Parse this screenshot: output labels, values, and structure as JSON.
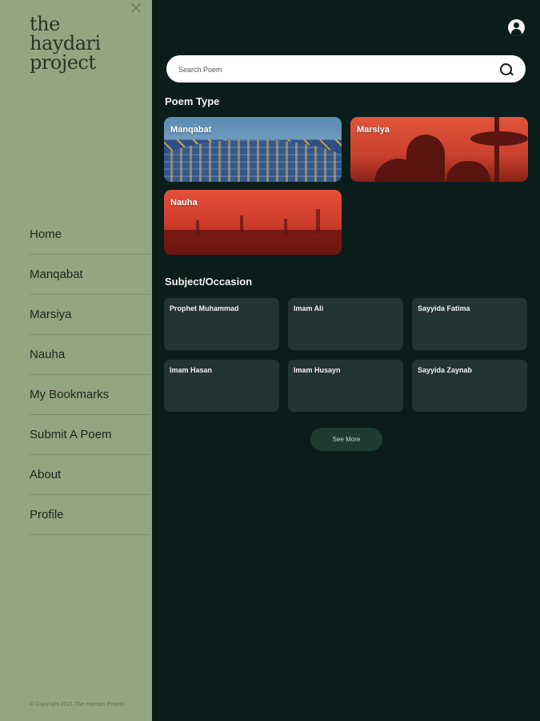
{
  "drawer": {
    "close_label": "✕",
    "logo_lines": [
      "the",
      "haydari",
      "project"
    ],
    "nav": [
      "Home",
      "Manqabat",
      "Marsiya",
      "Nauha",
      "My Bookmarks",
      "Submit A Poem",
      "About",
      "Profile"
    ],
    "copyright": "© Copyright 2021 The Haydari Project"
  },
  "search": {
    "placeholder": "Search Poem"
  },
  "poem_type": {
    "title": "Poem Type",
    "cards": [
      "Manqabat",
      "Marsiya",
      "Nauha"
    ]
  },
  "subject": {
    "title": "Subject/Occasion",
    "cards": [
      "Prophet Muhammad",
      "Imam Ali",
      "Sayyida Fatima",
      "Imam Hasan",
      "Imam Husayn",
      "Sayyida Zaynab"
    ]
  },
  "see_more": "See More",
  "colors": {
    "background": "#0b1d1b",
    "drawer": "#93a682",
    "card": "#233533",
    "see_more_bg": "#1f3a2e"
  }
}
